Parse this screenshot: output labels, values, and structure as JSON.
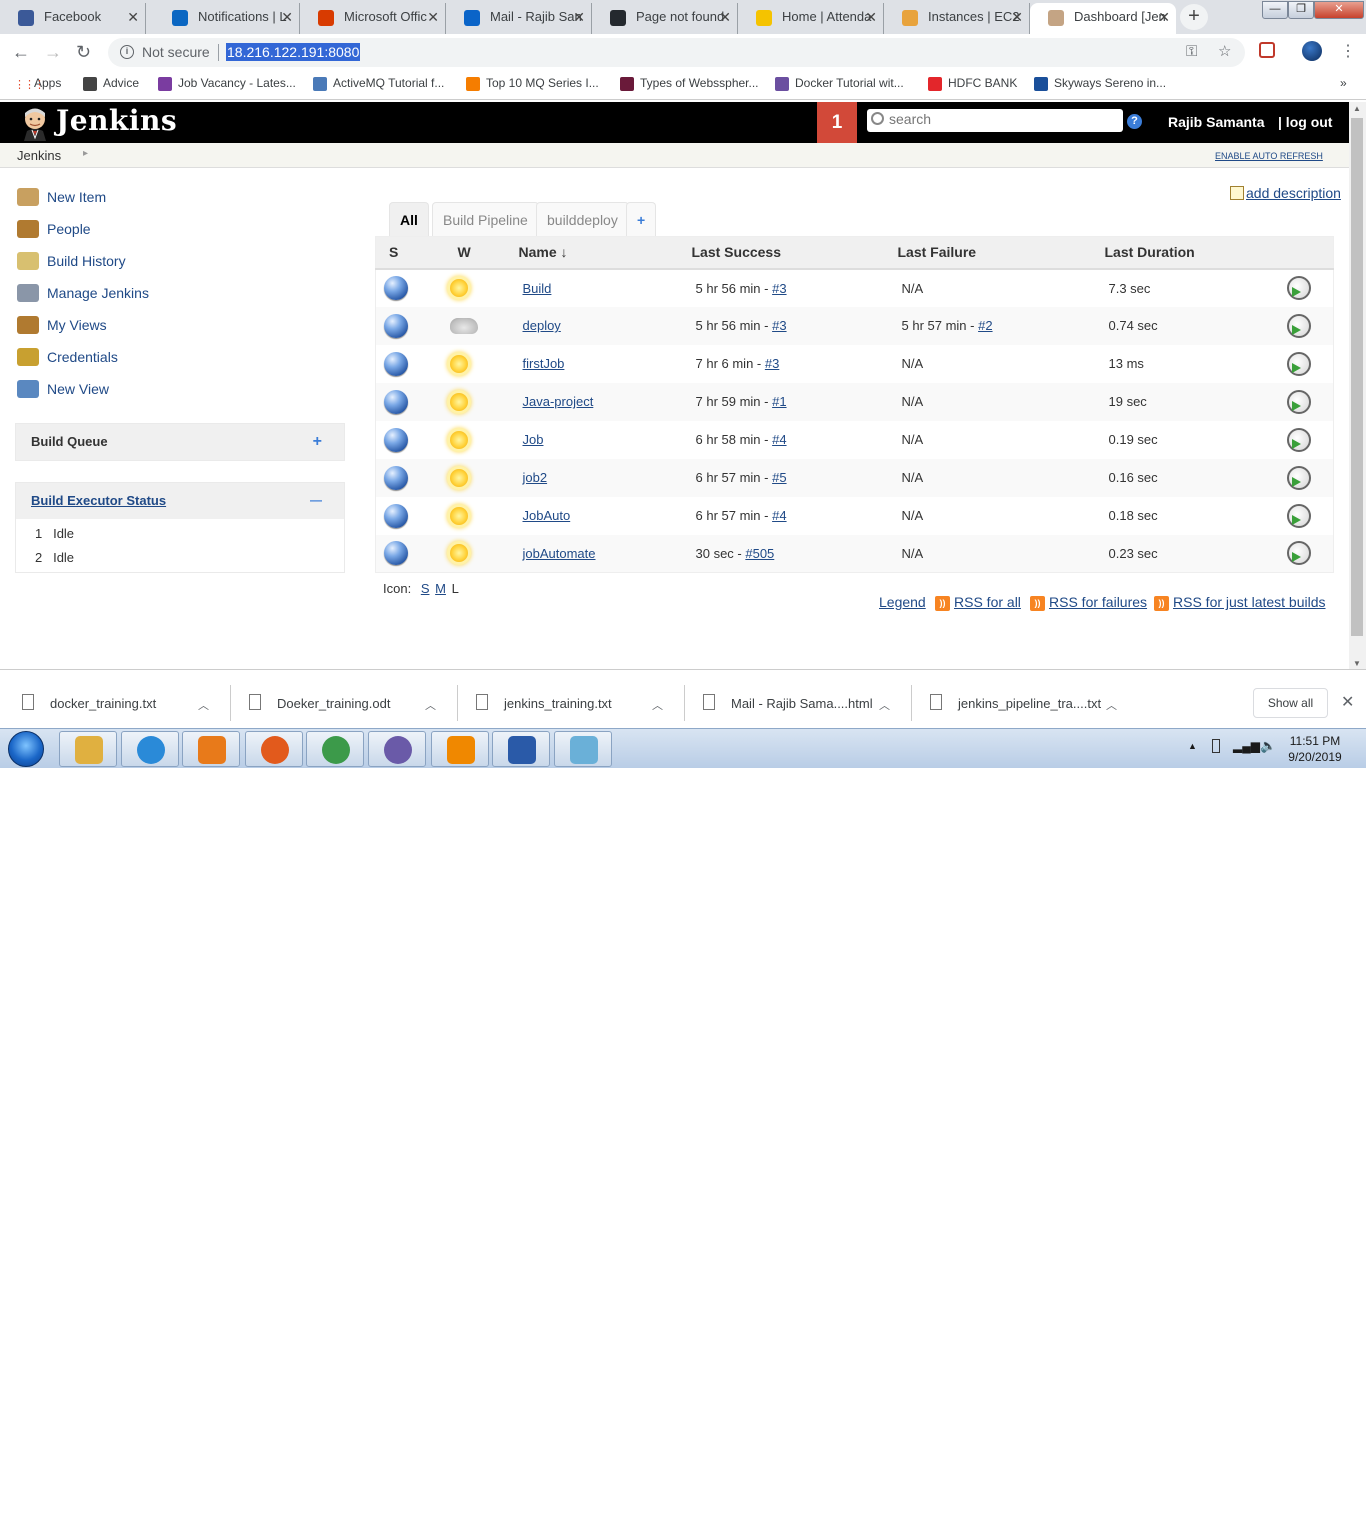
{
  "browser": {
    "tabs": [
      {
        "label": "Facebook",
        "color": "#3b5998"
      },
      {
        "label": "Notifications | L",
        "color": "#0a66c2"
      },
      {
        "label": "Microsoft Offic",
        "color": "#d83b01"
      },
      {
        "label": "Mail - Rajib San",
        "color": "#0a64c8"
      },
      {
        "label": "Page not found",
        "color": "#24292e"
      },
      {
        "label": "Home | Attenda",
        "color": "#f5c300"
      },
      {
        "label": "Instances | EC2",
        "color": "#e8a33c"
      },
      {
        "label": "Dashboard [Jen",
        "color": "#c4a484"
      }
    ],
    "new_tab": "+",
    "not_secure": "Not secure",
    "url": "18.216.122.191:8080",
    "bookmarks": [
      {
        "label": "Apps",
        "color": "#e24b2c"
      },
      {
        "label": "Advice",
        "color": "#444"
      },
      {
        "label": "Job Vacancy - Lates...",
        "color": "#7a3ca0"
      },
      {
        "label": "ActiveMQ Tutorial f...",
        "color": "#4a7ab8"
      },
      {
        "label": "Top 10 MQ Series I...",
        "color": "#f57d00"
      },
      {
        "label": "Types of Websspher...",
        "color": "#6a1a3a"
      },
      {
        "label": "Docker Tutorial wit...",
        "color": "#6b4fa0"
      },
      {
        "label": "HDFC BANK",
        "color": "#e3262b"
      },
      {
        "label": "Skyways Sereno in...",
        "color": "#1a4f9a"
      }
    ],
    "more": "»"
  },
  "jenkins": {
    "logo": "Jenkins",
    "notifications": "1",
    "search_placeholder": "search",
    "help": "?",
    "user": "Rajib Samanta",
    "logout": "| log out",
    "breadcrumb": "Jenkins",
    "auto_refresh": "ENABLE AUTO REFRESH",
    "tasks": [
      {
        "label": "New Item",
        "color": "#c8a060"
      },
      {
        "label": "People",
        "color": "#b07a30"
      },
      {
        "label": "Build History",
        "color": "#d8c070"
      },
      {
        "label": "Manage Jenkins",
        "color": "#8a96a8"
      },
      {
        "label": "My Views",
        "color": "#b07a30"
      },
      {
        "label": "Credentials",
        "color": "#c8a030"
      },
      {
        "label": "New View",
        "color": "#5a88c0"
      }
    ],
    "build_queue": {
      "title": "Build Queue",
      "toggle": "+"
    },
    "executor": {
      "title": "Build Executor Status",
      "toggle": "—",
      "rows": [
        {
          "num": "1",
          "state": "Idle"
        },
        {
          "num": "2",
          "state": "Idle"
        }
      ]
    },
    "add_description": "add description",
    "view_tabs": [
      "All",
      "Build Pipeline",
      "builddeploy",
      "+"
    ],
    "columns": {
      "s": "S",
      "w": "W",
      "name": "Name",
      "sort": "↓",
      "last_success": "Last Success",
      "last_failure": "Last Failure",
      "last_duration": "Last Duration"
    },
    "jobs": [
      {
        "name": "Build",
        "weather": "sunny",
        "ls_time": "5 hr 56 min - ",
        "ls_build": "#3",
        "lf_time": "N/A",
        "lf_build": "",
        "duration": "7.3 sec"
      },
      {
        "name": "deploy",
        "weather": "cloudy",
        "ls_time": "5 hr 56 min - ",
        "ls_build": "#3",
        "lf_time": "5 hr 57 min - ",
        "lf_build": "#2",
        "duration": "0.74 sec"
      },
      {
        "name": "firstJob",
        "weather": "sunny",
        "ls_time": "7 hr 6 min - ",
        "ls_build": "#3",
        "lf_time": "N/A",
        "lf_build": "",
        "duration": "13 ms"
      },
      {
        "name": "Java-project",
        "weather": "sunny",
        "ls_time": "7 hr 59 min - ",
        "ls_build": "#1",
        "lf_time": "N/A",
        "lf_build": "",
        "duration": "19 sec"
      },
      {
        "name": "Job",
        "weather": "sunny",
        "ls_time": "6 hr 58 min - ",
        "ls_build": "#4",
        "lf_time": "N/A",
        "lf_build": "",
        "duration": "0.19 sec"
      },
      {
        "name": "job2",
        "weather": "sunny",
        "ls_time": "6 hr 57 min - ",
        "ls_build": "#5",
        "lf_time": "N/A",
        "lf_build": "",
        "duration": "0.16 sec"
      },
      {
        "name": "JobAuto",
        "weather": "sunny",
        "ls_time": "6 hr 57 min - ",
        "ls_build": "#4",
        "lf_time": "N/A",
        "lf_build": "",
        "duration": "0.18 sec"
      },
      {
        "name": "jobAutomate",
        "weather": "sunny",
        "ls_time": "30 sec - ",
        "ls_build": "#505",
        "lf_time": "N/A",
        "lf_build": "",
        "duration": "0.23 sec"
      }
    ],
    "icon_size": {
      "label": "Icon:",
      "s": "S",
      "m": "M",
      "l": "L"
    },
    "legend": "Legend",
    "rss": [
      "RSS for all",
      "RSS for failures",
      "RSS for just latest builds"
    ]
  },
  "downloads": {
    "items": [
      "docker_training.txt",
      "Doeker_training.odt",
      "jenkins_training.txt",
      "Mail - Rajib Sama....html",
      "jenkins_pipeline_tra....txt"
    ],
    "show_all": "Show all",
    "close": "✕"
  },
  "taskbar": {
    "apps": [
      {
        "name": "explorer",
        "color": "#e0b040"
      },
      {
        "name": "ie",
        "color": "#2a8ad8"
      },
      {
        "name": "media-player",
        "color": "#e87a1a"
      },
      {
        "name": "firefox",
        "color": "#e25a1c"
      },
      {
        "name": "chrome",
        "color": "#3c9a4a"
      },
      {
        "name": "media-app",
        "color": "#6a5aa8"
      },
      {
        "name": "vlc",
        "color": "#f08800"
      },
      {
        "name": "word",
        "color": "#2a5aa8"
      },
      {
        "name": "notepad",
        "color": "#6ab0d8"
      }
    ],
    "time": "11:51 PM",
    "date": "9/20/2019"
  }
}
